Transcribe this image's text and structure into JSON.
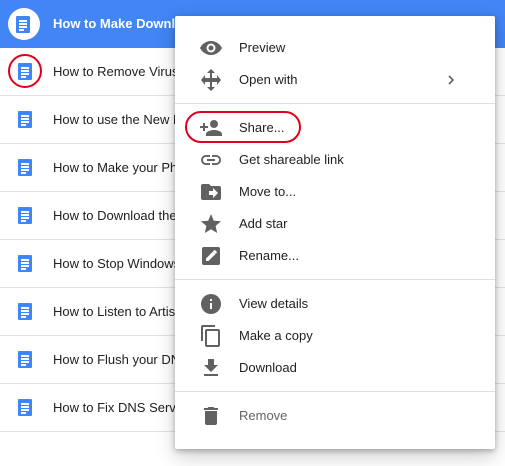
{
  "files": [
    {
      "name": "How to Make Download"
    },
    {
      "name": "How to Remove Virus"
    },
    {
      "name": "How to use the New B"
    },
    {
      "name": "How to Make your Ph"
    },
    {
      "name": "How to Download the"
    },
    {
      "name": "How to Stop Windows"
    },
    {
      "name": "How to Listen to Artis"
    },
    {
      "name": "How to Flush your DN"
    },
    {
      "name": "How to Fix DNS Serve"
    }
  ],
  "menu": {
    "preview": "Preview",
    "open_with": "Open with",
    "share": "Share...",
    "get_link": "Get shareable link",
    "move_to": "Move to...",
    "add_star": "Add star",
    "rename": "Rename...",
    "view_details": "View details",
    "make_copy": "Make a copy",
    "download": "Download",
    "remove": "Remove"
  },
  "colors": {
    "selection": "#4285f4",
    "highlight_ring": "#e0001b",
    "icon_gray": "#616161"
  },
  "icons": [
    "eye-icon",
    "move-arrows-icon",
    "add-person-icon",
    "link-icon",
    "folder-move-icon",
    "star-icon",
    "rename-icon",
    "info-icon",
    "copy-icon",
    "download-icon",
    "trash-icon",
    "chevron-right-icon",
    "doc-icon"
  ]
}
